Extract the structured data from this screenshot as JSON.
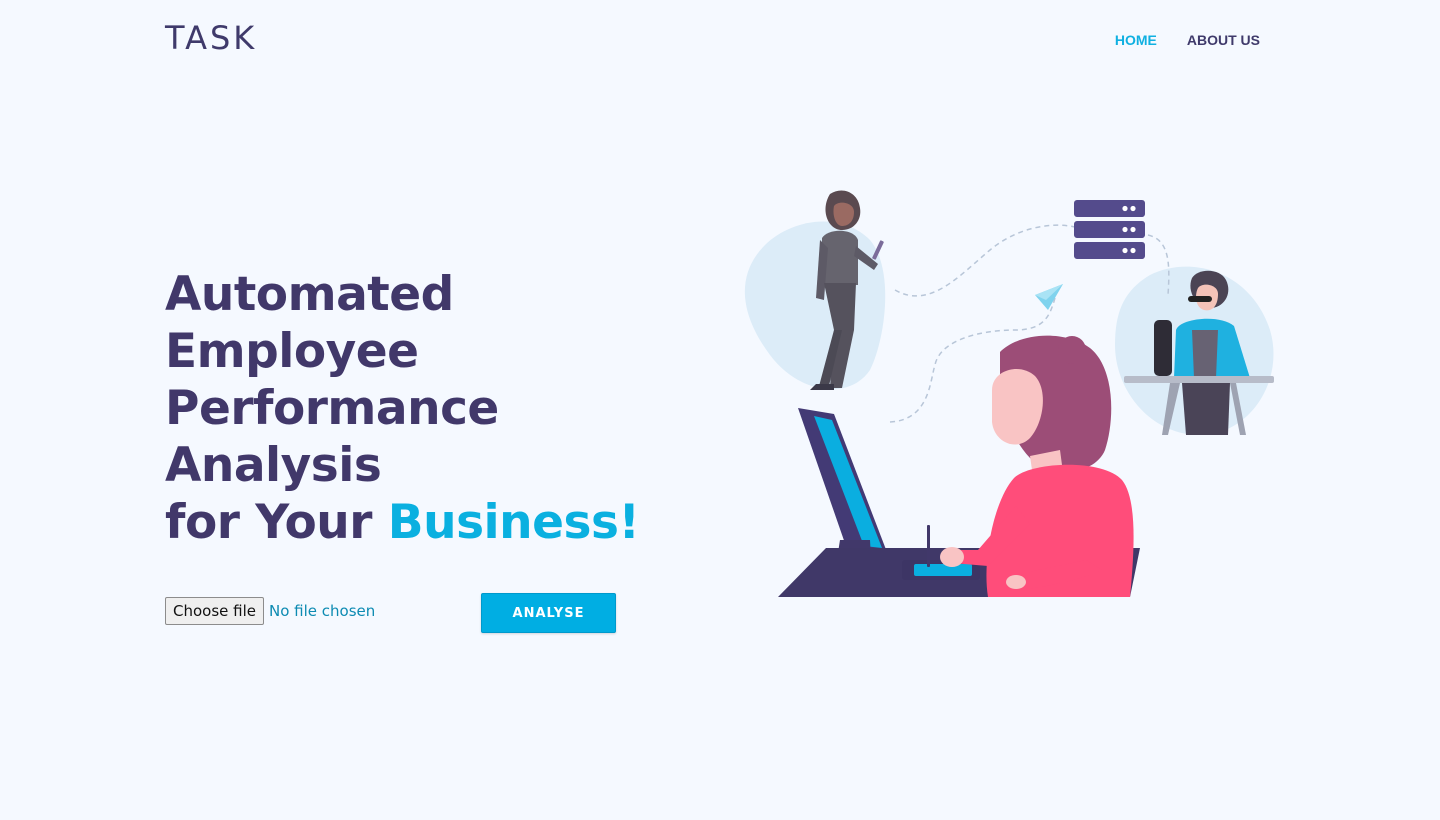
{
  "brand": {
    "logo": "TASK"
  },
  "nav": {
    "items": [
      {
        "label": "HOME",
        "active": true
      },
      {
        "label": "ABOUT US",
        "active": false
      }
    ]
  },
  "hero": {
    "lines": [
      "Automated",
      "Employee",
      "Performance",
      "Analysis"
    ],
    "last_line_prefix": "for Your ",
    "last_line_accent": "Business!"
  },
  "upload": {
    "choose_label": "Choose file",
    "status": "No file chosen"
  },
  "actions": {
    "analyse_label": "ANALYSE"
  },
  "colors": {
    "background": "#f5f9ff",
    "primary_text": "#41386a",
    "accent": "#0ab0e0",
    "button": "#00aee3"
  },
  "icons": {
    "illustration": "team-collaboration-illustration",
    "server": "server-stack-icon",
    "paper_plane": "paper-plane-icon"
  }
}
